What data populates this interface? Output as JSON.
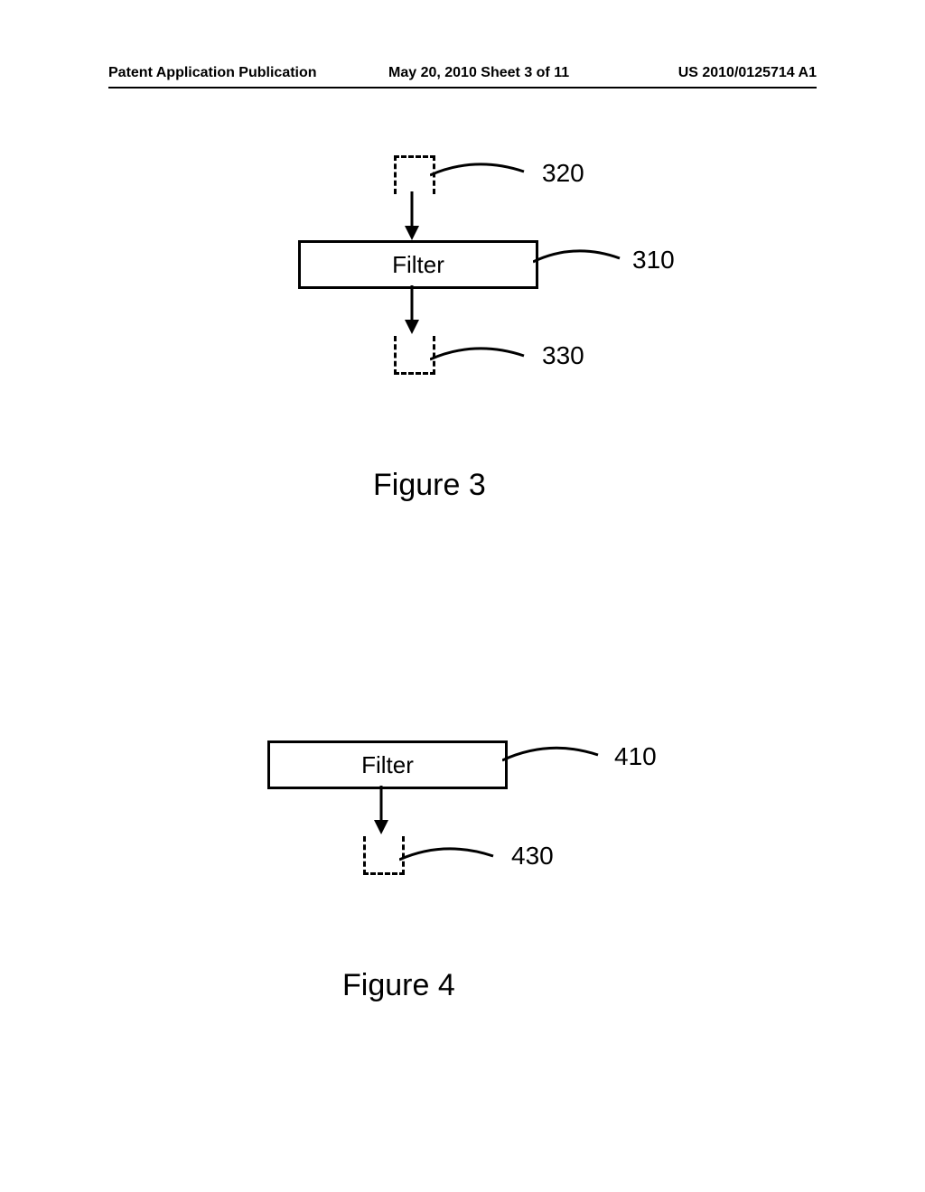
{
  "header": {
    "left": "Patent Application Publication",
    "mid": "May 20, 2010  Sheet 3 of 11",
    "right": "US 2010/0125714 A1"
  },
  "figure3": {
    "box_label": "Filter",
    "ref_top": "320",
    "ref_mid": "310",
    "ref_bot": "330",
    "caption": "Figure 3"
  },
  "figure4": {
    "box_label": "Filter",
    "ref_mid": "410",
    "ref_bot": "430",
    "caption": "Figure 4"
  }
}
